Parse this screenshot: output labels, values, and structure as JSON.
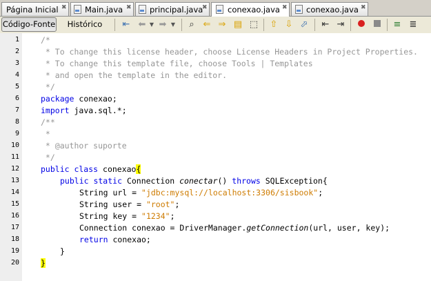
{
  "tabs": [
    {
      "label": "Página Inicial",
      "close": "✖",
      "active": false
    },
    {
      "label": "Main.java",
      "close": "✖",
      "active": false
    },
    {
      "label": "principal.java",
      "close": "✖",
      "active": false
    },
    {
      "label": "conexao.java",
      "close": "✖",
      "active": true
    },
    {
      "label": "conexao.java",
      "close": "✖",
      "active": false
    }
  ],
  "toolbar": {
    "source_label": "Código-Fonte",
    "history_label": "Histórico",
    "icons": [
      "back-icon",
      "forward-history-icon",
      "forward-history-icon",
      "find-icon",
      "find-previous-icon",
      "find-next-icon",
      "toggle-highlight-icon",
      "toggle-rect-selection-icon",
      "previous-bookmark-icon",
      "next-bookmark-icon",
      "toggle-bookmark-icon",
      "shift-left-icon",
      "shift-right-icon",
      "start-macro-icon",
      "stop-macro-icon",
      "comment-icon",
      "uncomment-icon"
    ]
  },
  "editor": {
    "line_numbers": [
      "1",
      "2",
      "3",
      "4",
      "5",
      "6",
      "7",
      "8",
      "9",
      "10",
      "11",
      "12",
      "13",
      "14",
      "15",
      "16",
      "17",
      "18",
      "19",
      "20"
    ],
    "lines": {
      "l1": "/*",
      "l2": " * To change this license header, choose License Headers in Project Properties.",
      "l3": " * To change this template file, choose Tools | Templates",
      "l4": " * and open the template in the editor.",
      "l5": " */",
      "l6_kw": "package",
      "l6_rest": " conexao;",
      "l7_kw": "import",
      "l7_rest": " java.sql.*;",
      "l8": "/**",
      "l9": " *",
      "l10": " * @author suporte",
      "l11": " */",
      "l12_kw": "public class",
      "l12_name": " conexao",
      "l12_brace": "{",
      "l13_kw": "public static",
      "l13_type": " Connection ",
      "l13_method": "conectar",
      "l13_paren": "() ",
      "l13_throws": "throws",
      "l13_rest": " SQLException{",
      "l14_a": "String url = ",
      "l14_str": "\"jdbc:mysql://localhost:3306/sisbook\"",
      "l14_b": ";",
      "l15_a": "String user = ",
      "l15_str": "\"root\"",
      "l15_b": ";",
      "l16_a": "String key = ",
      "l16_str": "\"1234\"",
      "l16_b": ";",
      "l17_a": "Connection conexao = DriverManager.",
      "l17_method": "getConnection",
      "l17_b": "(url, user, key);",
      "l18_kw": "return",
      "l18_rest": " conexao;",
      "l19": "}",
      "l20": "}"
    }
  },
  "colors": {
    "keyword": "#0000e6",
    "comment": "#969696",
    "string": "#ce7b00",
    "brace_highlight": "#ffff00",
    "current_line": "#e9eff8"
  }
}
